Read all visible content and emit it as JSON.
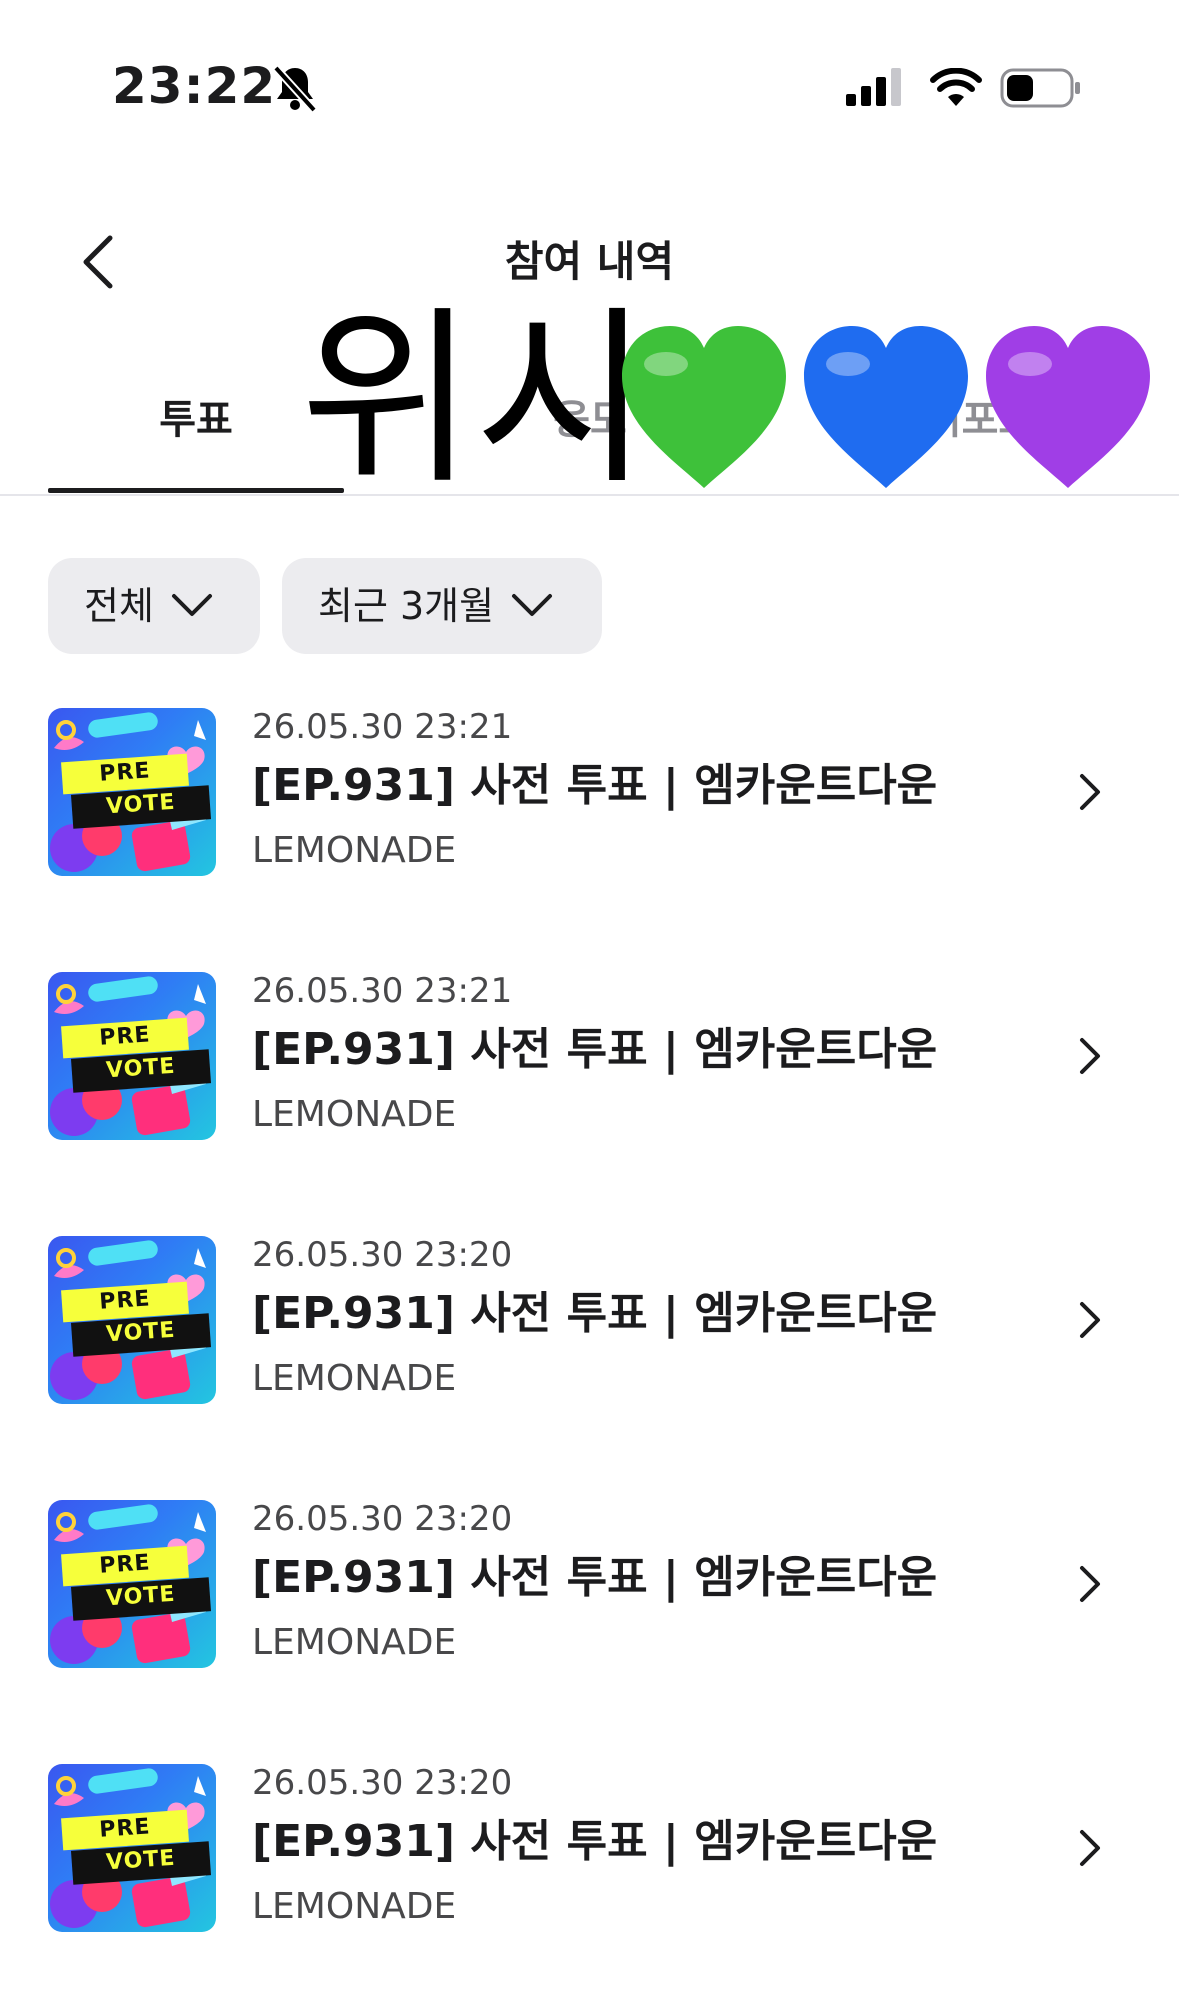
{
  "status_bar": {
    "time": "23:22",
    "bell_icon": "bell-slash-icon",
    "signal_icon": "cellular-signal-icon",
    "wifi_icon": "wifi-icon",
    "battery_icon": "battery-icon"
  },
  "header": {
    "title": "참여 내역",
    "back_icon": "chevron-left-icon"
  },
  "tabs": [
    {
      "label": "투표",
      "active": true
    },
    {
      "label": "응모",
      "active": false
    },
    {
      "label": "서포트",
      "active": false
    }
  ],
  "sticker": {
    "text": "위시",
    "hearts": [
      "#3ec13a",
      "#1f6cf0",
      "#a03ee6"
    ]
  },
  "filters": [
    {
      "label": "전체"
    },
    {
      "label": "최근 3개월"
    }
  ],
  "thumbnail": {
    "line1": "PRE",
    "line2": "VOTE"
  },
  "items": [
    {
      "date": "26.05.30 23:21",
      "title": "[EP.931] 사전 투표 | 엠카운트다운",
      "artist": "LEMONADE"
    },
    {
      "date": "26.05.30 23:21",
      "title": "[EP.931] 사전 투표 | 엠카운트다운",
      "artist": "LEMONADE"
    },
    {
      "date": "26.05.30 23:20",
      "title": "[EP.931] 사전 투표 | 엠카운트다운",
      "artist": "LEMONADE"
    },
    {
      "date": "26.05.30 23:20",
      "title": "[EP.931] 사전 투표 | 엠카운트다운",
      "artist": "LEMONADE"
    },
    {
      "date": "26.05.30 23:20",
      "title": "[EP.931] 사전 투표 | 엠카운트다운",
      "artist": "LEMONADE"
    }
  ]
}
